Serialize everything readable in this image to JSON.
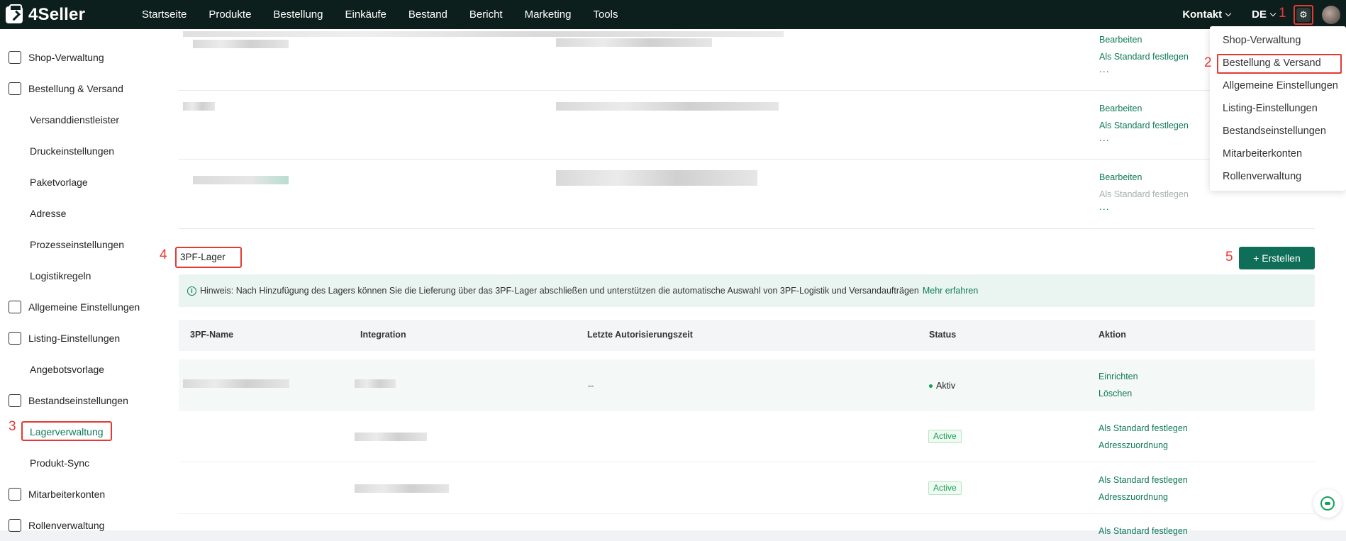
{
  "brand": {
    "name": "4Seller"
  },
  "topnav": [
    "Startseite",
    "Produkte",
    "Bestellung",
    "Einkäufe",
    "Bestand",
    "Bericht",
    "Marketing",
    "Tools"
  ],
  "topright": {
    "contact": "Kontakt",
    "language": "DE"
  },
  "annotations": {
    "a1": "1",
    "a2": "2",
    "a3": "3",
    "a4": "4",
    "a5": "5"
  },
  "sidebar": {
    "items": [
      {
        "label": "Shop-Verwaltung",
        "icon": "store-icon"
      },
      {
        "label": "Bestellung & Versand",
        "icon": "order-bag-icon"
      },
      {
        "label": "Versanddienstleister"
      },
      {
        "label": "Druckeinstellungen"
      },
      {
        "label": "Paketvorlage"
      },
      {
        "label": "Adresse"
      },
      {
        "label": "Prozesseinstellungen"
      },
      {
        "label": "Logistikregeln"
      },
      {
        "label": "Allgemeine Einstellungen",
        "icon": "settings-doc-icon"
      },
      {
        "label": "Listing-Einstellungen",
        "icon": "upload-box-icon"
      },
      {
        "label": "Angebotsvorlage"
      },
      {
        "label": "Bestandseinstellungen",
        "icon": "inventory-icon"
      },
      {
        "label": "Lagerverwaltung"
      },
      {
        "label": "Produkt-Sync"
      },
      {
        "label": "Mitarbeiterkonten",
        "icon": "staff-icon"
      },
      {
        "label": "Rollenverwaltung",
        "icon": "role-icon"
      }
    ]
  },
  "upper_rows": [
    {
      "actions": [
        "Bearbeiten",
        "Als Standard festlegen",
        "..."
      ]
    },
    {
      "actions": [
        "Bearbeiten",
        "Als Standard festlegen",
        "..."
      ]
    },
    {
      "actions": [
        "Bearbeiten",
        "Als Standard festlegen",
        "..."
      ]
    }
  ],
  "section": {
    "title": "3PF-Lager",
    "create_label": "+ Erstellen",
    "hint": "Hinweis: Nach Hinzufügung des Lagers können Sie die Lieferung über das 3PF-Lager abschließen und unterstützen die automatische Auswahl von 3PF-Logistik und Versandaufträgen",
    "hint_link": "Mehr erfahren"
  },
  "table": {
    "headers": [
      "3PF-Name",
      "Integration",
      "Letzte Autorisierungszeit",
      "Status",
      "Aktion"
    ],
    "rows": [
      {
        "auth_time": "--",
        "status": "Aktiv",
        "actions": [
          "Einrichten",
          "Löschen"
        ]
      },
      {
        "status": "Active",
        "actions": [
          "Als Standard festlegen",
          "Adresszuordnung"
        ]
      },
      {
        "status": "Active",
        "actions": [
          "Als Standard festlegen",
          "Adresszuordnung"
        ]
      },
      {
        "actions": [
          "Als Standard festlegen"
        ]
      }
    ]
  },
  "settings_menu": [
    "Shop-Verwaltung",
    "Bestellung & Versand",
    "Allgemeine Einstellungen",
    "Listing-Einstellungen",
    "Bestandseinstellungen",
    "Mitarbeiterkonten",
    "Rollenverwaltung"
  ]
}
